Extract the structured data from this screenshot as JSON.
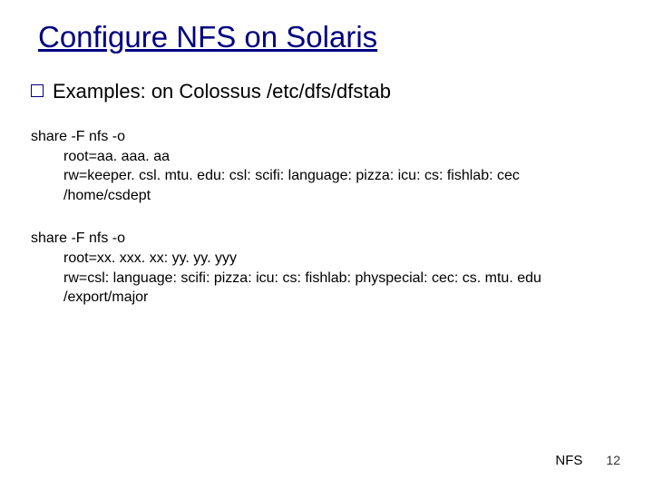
{
  "slide": {
    "title": "Configure NFS on Solaris",
    "bullet": "Examples: on Colossus /etc/dfs/dfstab",
    "block1": {
      "l1": "share  -F nfs -o",
      "l2": "root=aa. aaa. aa",
      "l3": "rw=keeper. csl. mtu. edu: csl: scifi: language: pizza: icu: cs: fishlab: cec",
      "l4": "/home/csdept"
    },
    "block2": {
      "l1": "share  -F nfs -o",
      "l2": "root=xx. xxx. xx: yy. yy. yyy",
      "l3": "rw=csl: language: scifi: pizza: icu: cs: fishlab: physpecial: cec: cs. mtu. edu",
      "l4": "/export/major"
    },
    "footer": {
      "label": "NFS",
      "page": "12"
    }
  }
}
